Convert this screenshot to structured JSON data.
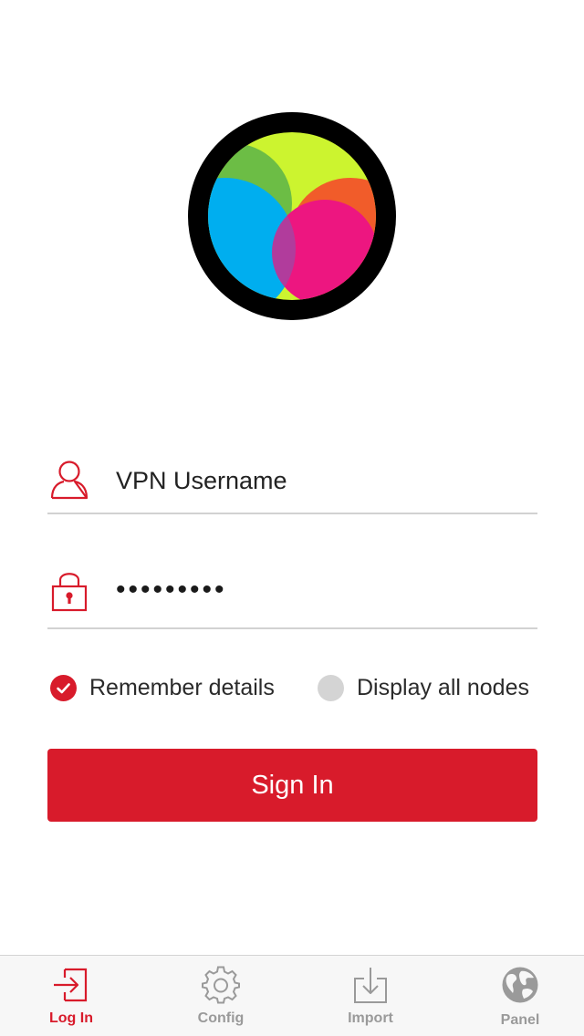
{
  "logo": {
    "icon": "color-wheel-logo"
  },
  "login_form": {
    "username": {
      "icon": "user-icon",
      "placeholder": "VPN Username",
      "value": ""
    },
    "password": {
      "icon": "lock-icon",
      "value": "•••••••••"
    },
    "remember_details": {
      "label": "Remember details",
      "checked": true
    },
    "display_all_nodes": {
      "label": "Display all nodes",
      "checked": false
    },
    "sign_in_label": "Sign In"
  },
  "tab_bar": {
    "tabs": [
      {
        "label": "Log In",
        "icon": "login-icon",
        "active": true
      },
      {
        "label": "Config",
        "icon": "gear-icon",
        "active": false
      },
      {
        "label": "Import",
        "icon": "import-icon",
        "active": false
      },
      {
        "label": "Panel",
        "icon": "globe-icon",
        "active": false
      }
    ]
  },
  "colors": {
    "accent": "#d81b2b",
    "inactive": "#9a9a9a",
    "divider": "#d2d2d2"
  }
}
